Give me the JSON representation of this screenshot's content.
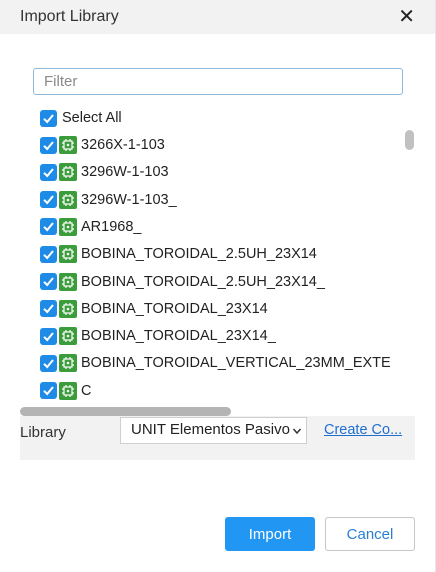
{
  "dialog": {
    "title": "Import Library",
    "close_glyph": "✕"
  },
  "filter": {
    "placeholder": "Filter",
    "value": ""
  },
  "list": {
    "select_all": {
      "label": "Select All",
      "checked": true
    },
    "items": [
      {
        "label": "3266X-1-103",
        "checked": true,
        "icon": "component-chip-icon"
      },
      {
        "label": "3296W-1-103",
        "checked": true,
        "icon": "component-chip-icon"
      },
      {
        "label": "3296W-1-103_",
        "checked": true,
        "icon": "component-chip-icon"
      },
      {
        "label": "AR1968_",
        "checked": true,
        "icon": "component-chip-icon"
      },
      {
        "label": "BOBINA_TOROIDAL_2.5UH_23X14",
        "checked": true,
        "icon": "component-chip-icon"
      },
      {
        "label": "BOBINA_TOROIDAL_2.5UH_23X14_",
        "checked": true,
        "icon": "component-chip-icon"
      },
      {
        "label": "BOBINA_TOROIDAL_23X14",
        "checked": true,
        "icon": "component-chip-icon"
      },
      {
        "label": "BOBINA_TOROIDAL_23X14_",
        "checked": true,
        "icon": "component-chip-icon"
      },
      {
        "label": "BOBINA_TOROIDAL_VERTICAL_23MM_EXTE",
        "checked": true,
        "icon": "component-chip-icon"
      },
      {
        "label": "C",
        "checked": true,
        "icon": "component-chip-icon"
      }
    ]
  },
  "library": {
    "label": "Library",
    "selected": "UNIT Elementos Pasivo",
    "create_link": "Create Co..."
  },
  "footer": {
    "import_label": "Import",
    "cancel_label": "Cancel"
  },
  "colors": {
    "accent": "#2196f3",
    "checkbox": "#1e8ce6",
    "chip_icon": "#3a9c3a",
    "link": "#1f6fd1"
  }
}
